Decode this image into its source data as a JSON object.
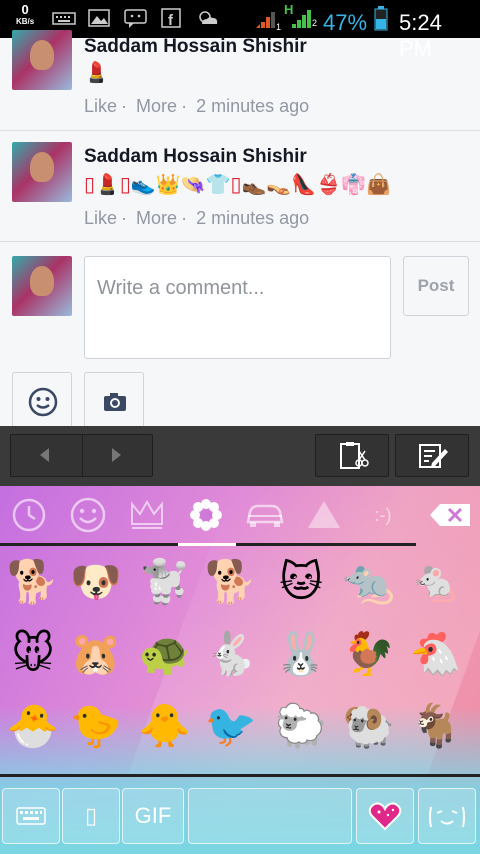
{
  "status_bar": {
    "speed_value": "0",
    "speed_unit": "KB/s",
    "network_h1": "H",
    "network_h2": "H",
    "sim1": "1",
    "sim2": "2",
    "battery": "47%",
    "time": "5:24 PM",
    "icons": [
      "keyboard-icon",
      "image-icon",
      "chat-icon",
      "facebook-icon",
      "weather-icon",
      "signal-icon",
      "battery-icon"
    ]
  },
  "comments": [
    {
      "name": "Saddam Hossain Shishir",
      "emoji": "💄",
      "like": "Like",
      "more": "More",
      "time": "2 minutes ago"
    },
    {
      "name": "Saddam Hossain Shishir",
      "emoji": "▯💄▯👟👑👒👕▯👞👡👠👙👘👜",
      "like": "Like",
      "more": "More",
      "time": "2 minutes ago"
    }
  ],
  "composer": {
    "placeholder": "Write a comment...",
    "post_label": "Post"
  },
  "keyboard": {
    "emoticon_tab": ":-)",
    "emoji_rows": [
      [
        "🐕",
        "🐶",
        "🐩",
        "🐕",
        "🐱",
        "🐀",
        "🐁"
      ],
      [
        "🐭",
        "🐹",
        "🐢",
        "🐇",
        "🐰",
        "🐓",
        "🐔"
      ],
      [
        "🐣",
        "🐤",
        "🐥",
        "🐦",
        "🐑",
        "🐏",
        "🐐"
      ]
    ],
    "gif_label": "GIF",
    "placeholder_glyph": "▯"
  }
}
